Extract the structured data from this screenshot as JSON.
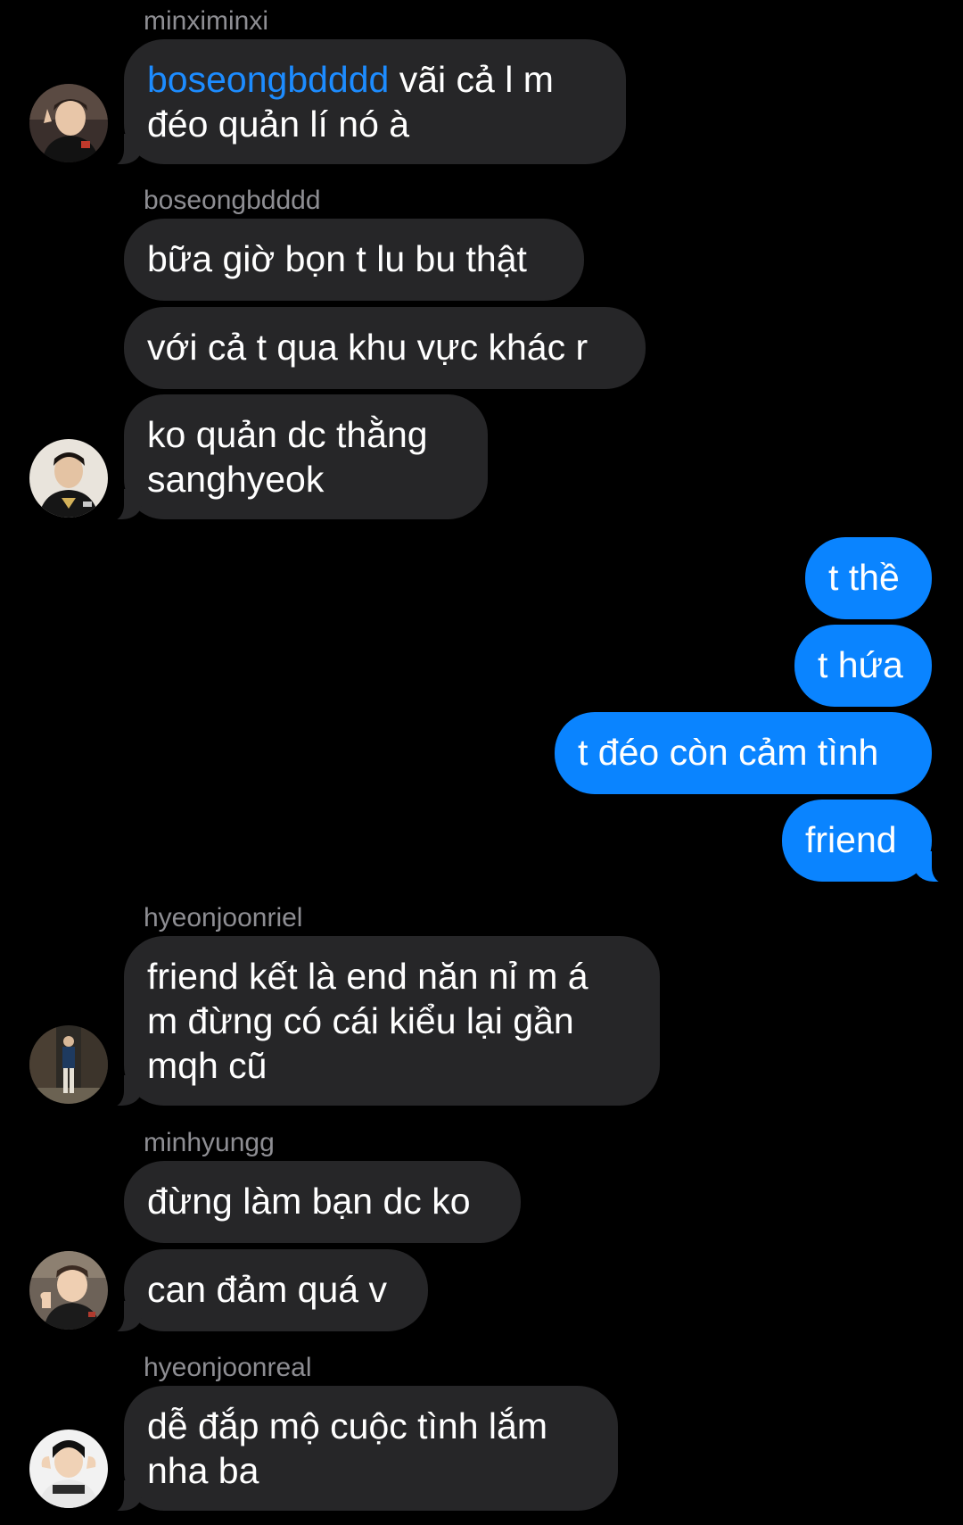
{
  "colors": {
    "background": "#000000",
    "incoming_bubble": "#262628",
    "outgoing_bubble": "#0a84ff",
    "mention": "#1d8cff",
    "sender_name": "#8e8e93"
  },
  "messages": {
    "m1": {
      "sender": "minximinxi",
      "mention": "boseongbdddd",
      "line1_rest": " vãi cả l m",
      "line2": "đéo quản lí nó à",
      "avatar_icon": "user-avatar-photo"
    },
    "m2": {
      "sender": "boseongbdddd",
      "b1": "bữa giờ bọn t lu bu thật",
      "b2": "với cả t qua khu vực khác r",
      "b3_line1": "ko quản dc thằng",
      "b3_line2": "sanghyeok",
      "avatar_icon": "user-avatar-photo"
    },
    "me": {
      "b1": "t thề",
      "b2": "t hứa",
      "b3": "t đéo còn cảm tình",
      "b4": "friend"
    },
    "m3": {
      "sender": "hyeonjoonriel",
      "line1": "friend kết là end năn nỉ m á",
      "line2": "m đừng có cái kiểu lại gần",
      "line3": "mqh cũ",
      "avatar_icon": "user-avatar-photo"
    },
    "m4": {
      "sender": "minhyungg",
      "b1": "đừng làm bạn dc ko",
      "b2": "can đảm quá v",
      "avatar_icon": "user-avatar-photo"
    },
    "m5": {
      "sender": "hyeonjoonreal",
      "line1": "dễ đắp mộ cuộc tình lắm",
      "line2": "nha ba",
      "avatar_icon": "user-avatar-photo"
    }
  }
}
